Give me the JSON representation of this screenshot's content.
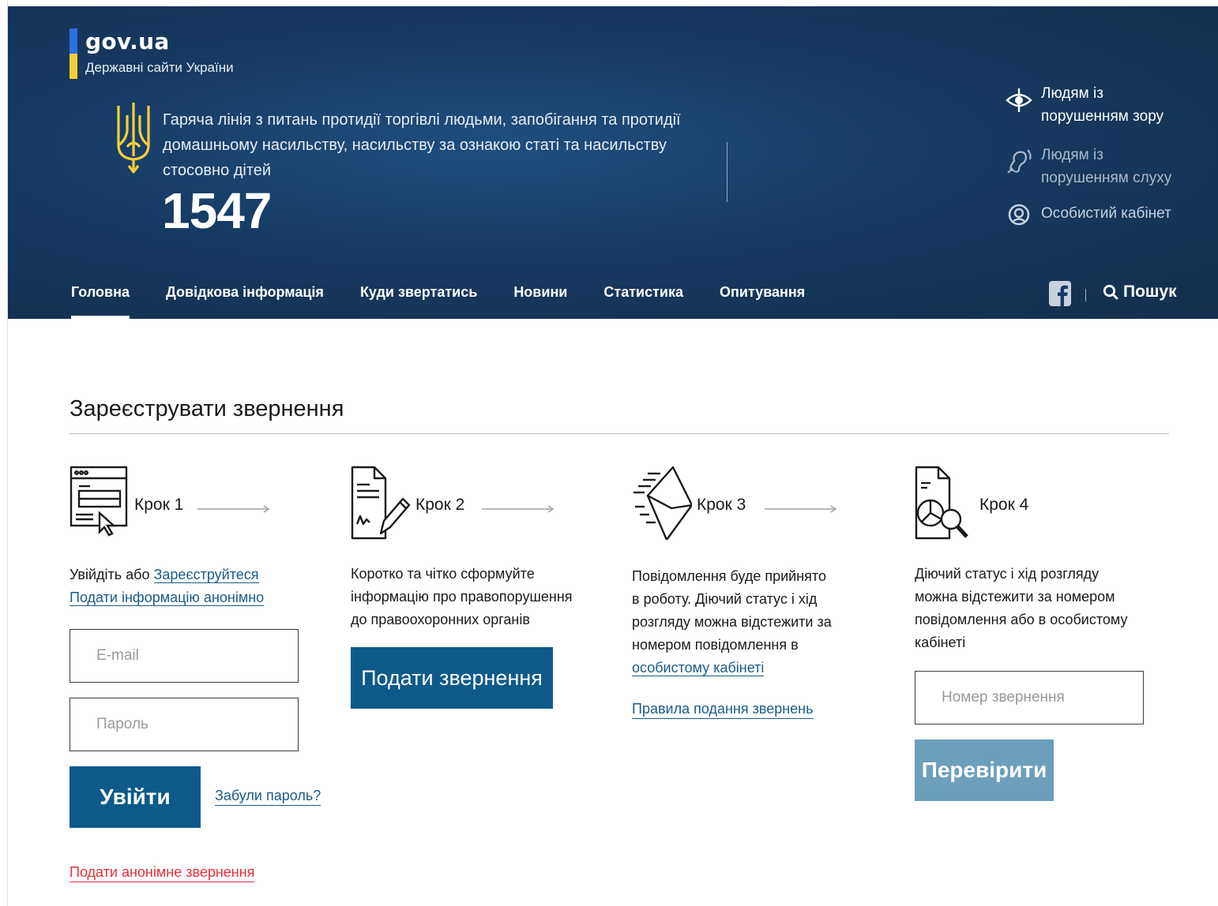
{
  "brand": {
    "name": "gov.ua",
    "subtitle": "Державні сайти України",
    "flag_blue": "#2c6fe0",
    "flag_yellow": "#f6cf35"
  },
  "hotline": {
    "title": "Гаряча лінія з питань протидії торгівлі людьми, запобігання та протидії домашньому насильству, насильству за ознакою статі та насильству стосовно дітей",
    "number": "1547"
  },
  "accessibility": [
    {
      "label_line1": "Людям із",
      "label_line2": "порушенням зору",
      "icon": "eye-icon"
    },
    {
      "label_line1": "Людям із",
      "label_line2": "порушенням слуху",
      "icon": "ear-icon"
    },
    {
      "label": "Особистий кабінет",
      "icon": "user-circle-icon"
    }
  ],
  "nav": {
    "items": [
      "Головна",
      "Довідкова інформація",
      "Куди звертатись",
      "Новини",
      "Статистика",
      "Опитування"
    ],
    "active": "Головна",
    "search_label": "Пошук"
  },
  "main": {
    "title": "Зареєструвати звернення",
    "steps": [
      {
        "label": "Крок 1",
        "icon": "browser-window-icon"
      },
      {
        "label": "Крок 2",
        "icon": "document-sign-icon"
      },
      {
        "label": "Крок 3",
        "icon": "send-envelope-icon"
      },
      {
        "label": "Крок 4",
        "icon": "report-search-icon"
      }
    ],
    "step1": {
      "login_prefix": "Увійдіть або",
      "register_link": "Зареєструйтеся",
      "anonymous_info_link": "Подати інформацію анонімно",
      "email_placeholder": "E-mail",
      "password_placeholder": "Пароль",
      "login_button": "Увійти",
      "forgot_link": "Забули пароль?",
      "anonymous_appeal_link": "Подати анонімне звернення"
    },
    "step2": {
      "text": "Коротко та чітко сформуйте інформацію про правопорушення до правоохоронних органів",
      "button": "Подати звернення"
    },
    "step3": {
      "text": "Повідомлення буде прийнято в роботу. Діючий статус і хід розгляду можна відстежити за номером повідомлення в",
      "cabinet_link": "особистому кабінеті",
      "rules_link": "Правила подання звернень"
    },
    "step4": {
      "text": "Діючий статус і хід розгляду можна відстежити за номером повідомлення або в особистому кабінеті",
      "number_placeholder": "Номер звернення",
      "check_button": "Перевірити"
    }
  },
  "colors": {
    "header_bg": "#163a63",
    "primary_button": "#0d5a8a",
    "disabled_button": "#6c9fbd",
    "link": "#1a5c8a",
    "link_red": "#e5303a"
  }
}
